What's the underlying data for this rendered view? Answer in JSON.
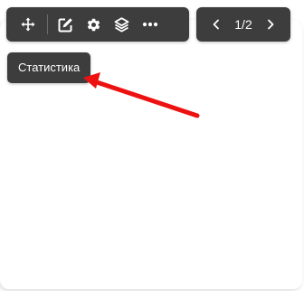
{
  "toolbar": {
    "buttons": [
      {
        "icon": "move-icon"
      },
      {
        "icon": "edit-icon"
      },
      {
        "icon": "settings-icon"
      },
      {
        "icon": "layers-icon"
      },
      {
        "icon": "more-icon"
      }
    ]
  },
  "pager": {
    "page_indicator": "1/2",
    "prev_icon": "chevron-left-icon",
    "next_icon": "chevron-right-icon"
  },
  "tooltip": {
    "text": "Статистика"
  },
  "colors": {
    "toolbar_bg": "#3d3d3d",
    "icon_color": "#ffffff",
    "annotation_arrow": "#ee1111"
  }
}
